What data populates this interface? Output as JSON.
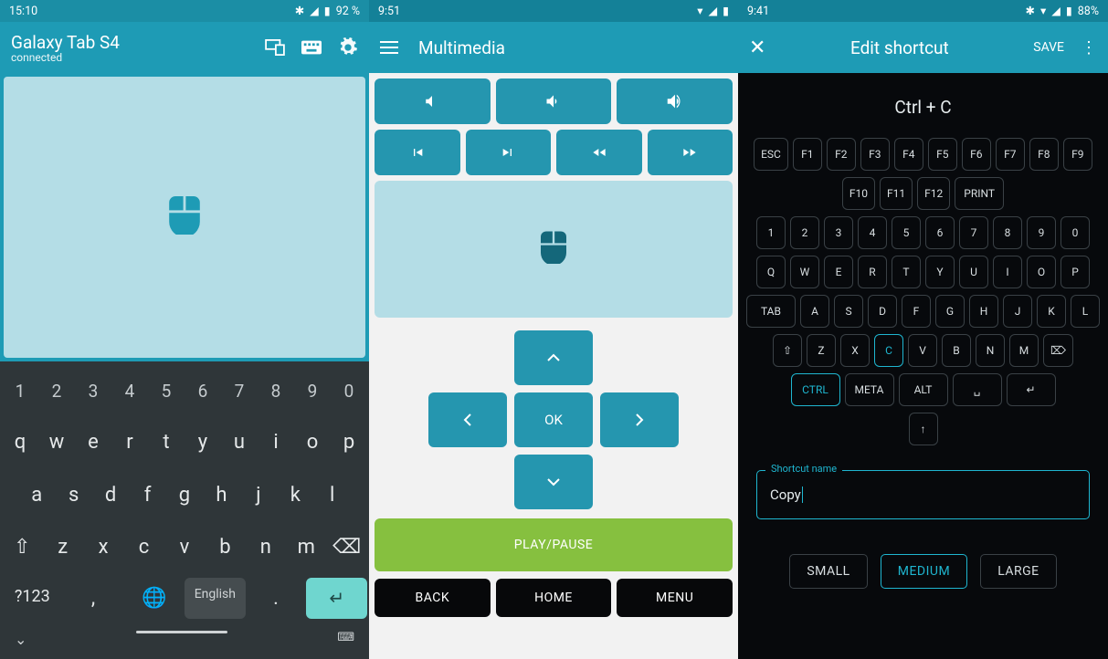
{
  "panel1": {
    "status": {
      "time": "15:10",
      "battery": "92 %"
    },
    "title": "Galaxy Tab S4",
    "subtitle": "connected",
    "keyboard": {
      "row1": [
        "1",
        "2",
        "3",
        "4",
        "5",
        "6",
        "7",
        "8",
        "9",
        "0"
      ],
      "row2": [
        "q",
        "w",
        "e",
        "r",
        "t",
        "y",
        "u",
        "i",
        "o",
        "p"
      ],
      "row3": [
        "a",
        "s",
        "d",
        "f",
        "g",
        "h",
        "j",
        "k",
        "l"
      ],
      "row4": [
        "⇧",
        "z",
        "x",
        "c",
        "v",
        "b",
        "n",
        "m",
        "⌫"
      ],
      "sym": "?123",
      "comma": ",",
      "period": ".",
      "language": "English"
    }
  },
  "panel2": {
    "status": {
      "time": "9:51"
    },
    "title": "Multimedia",
    "dpad_ok": "OK",
    "play_pause": "PLAY/PAUSE",
    "nav": {
      "back": "BACK",
      "home": "HOME",
      "menu": "MENU"
    }
  },
  "panel3": {
    "status": {
      "time": "9:41",
      "battery": "88%"
    },
    "title": "Edit shortcut",
    "save": "SAVE",
    "display": "Ctrl + C",
    "rows": {
      "fn1": [
        "ESC",
        "F1",
        "F2",
        "F3",
        "F4",
        "F5",
        "F6",
        "F7",
        "F8",
        "F9"
      ],
      "fn2": [
        "F10",
        "F11",
        "F12",
        "PRINT"
      ],
      "num": [
        "1",
        "2",
        "3",
        "4",
        "5",
        "6",
        "7",
        "8",
        "9",
        "0"
      ],
      "q": [
        "Q",
        "W",
        "E",
        "R",
        "T",
        "Y",
        "U",
        "I",
        "O",
        "P"
      ],
      "a": [
        "TAB",
        "A",
        "S",
        "D",
        "F",
        "G",
        "H",
        "J",
        "K",
        "L"
      ],
      "z": [
        "⇧",
        "Z",
        "X",
        "C",
        "V",
        "B",
        "N",
        "M",
        "⌦"
      ],
      "mod": [
        "CTRL",
        "META",
        "ALT",
        "␣",
        "↵"
      ],
      "arrow_up": "↑"
    },
    "selected_keys": [
      "CTRL",
      "C"
    ],
    "field_label": "Shortcut name",
    "field_value": "Copy",
    "sizes": [
      "SMALL",
      "MEDIUM",
      "LARGE"
    ],
    "size_selected": "MEDIUM"
  }
}
